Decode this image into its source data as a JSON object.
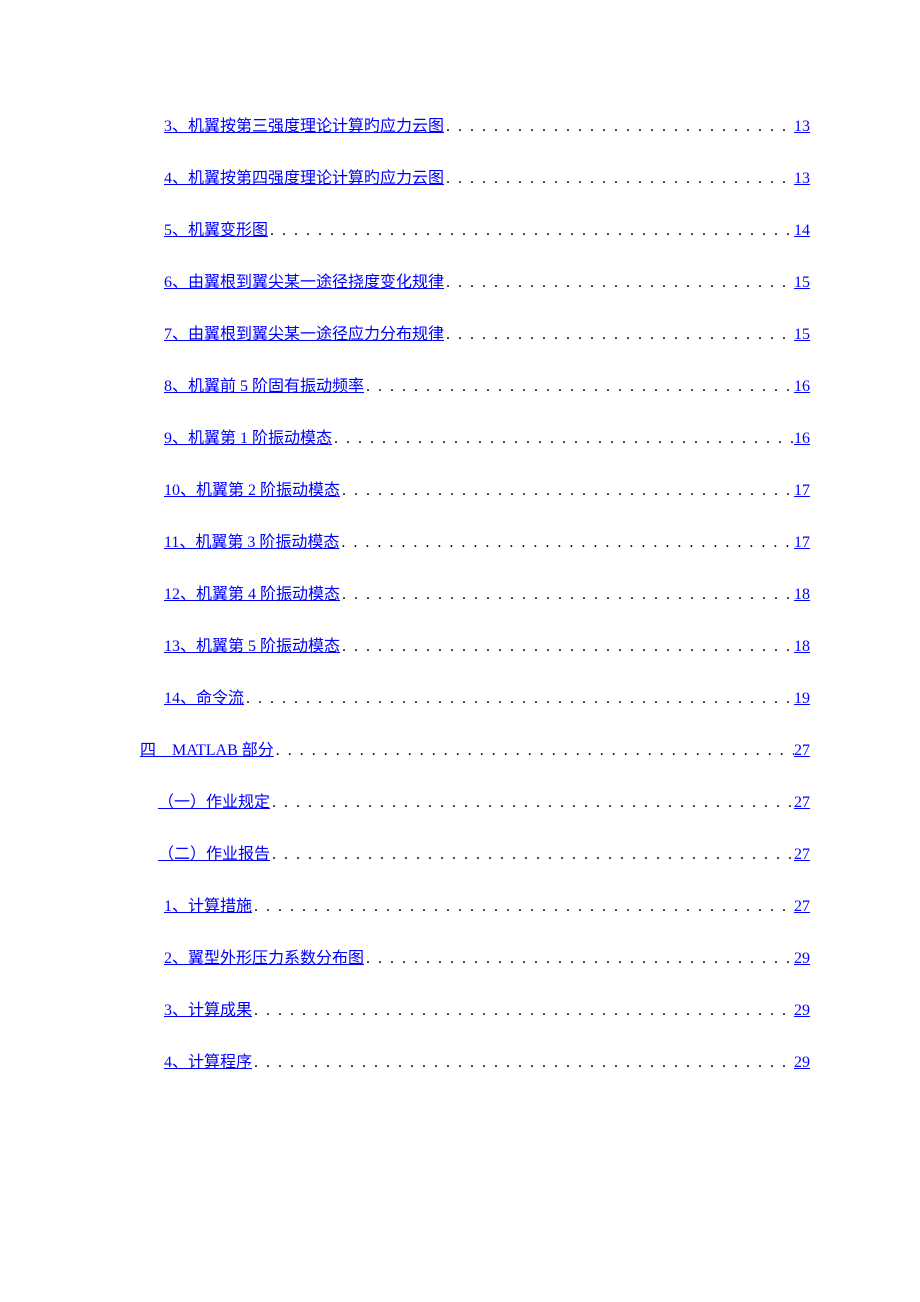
{
  "toc": [
    {
      "level": 3,
      "text": "3、机翼按第三强度理论计算旳应力云图",
      "page": "13"
    },
    {
      "level": 3,
      "text": "4、机翼按第四强度理论计算旳应力云图",
      "page": "13"
    },
    {
      "level": 3,
      "text": "5、机翼变形图",
      "page": "14"
    },
    {
      "level": 3,
      "text": "6、由翼根到翼尖某一途径挠度变化规律",
      "page": "15"
    },
    {
      "level": 3,
      "text": "7、由翼根到翼尖某一途径应力分布规律",
      "page": "15"
    },
    {
      "level": 3,
      "text": "8、机翼前 5 阶固有振动频率",
      "page": "16"
    },
    {
      "level": 3,
      "text": "9、机翼第 1 阶振动模态",
      "page": "16"
    },
    {
      "level": 3,
      "text": "10、机翼第 2 阶振动模态",
      "page": "17"
    },
    {
      "level": 3,
      "text": "11、机翼第 3 阶振动模态",
      "page": "17"
    },
    {
      "level": 3,
      "text": "12、机翼第 4 阶振动模态",
      "page": "18"
    },
    {
      "level": 3,
      "text": "13、机翼第 5 阶振动模态",
      "page": "18"
    },
    {
      "level": 3,
      "text": "14、命令流",
      "page": "19"
    },
    {
      "level": 1,
      "text": "四　MATLAB 部分",
      "page": "27",
      "gap": true
    },
    {
      "level": 2,
      "text": "（一）作业规定",
      "page": "27"
    },
    {
      "level": 2,
      "text": "（二）作业报告",
      "page": "27"
    },
    {
      "level": 3,
      "text": "1、计算措施",
      "page": "27"
    },
    {
      "level": 3,
      "text": "2、翼型外形压力系数分布图",
      "page": "29"
    },
    {
      "level": 3,
      "text": "3、计算成果",
      "page": "29"
    },
    {
      "level": 3,
      "text": "4、计算程序",
      "page": "29"
    }
  ]
}
